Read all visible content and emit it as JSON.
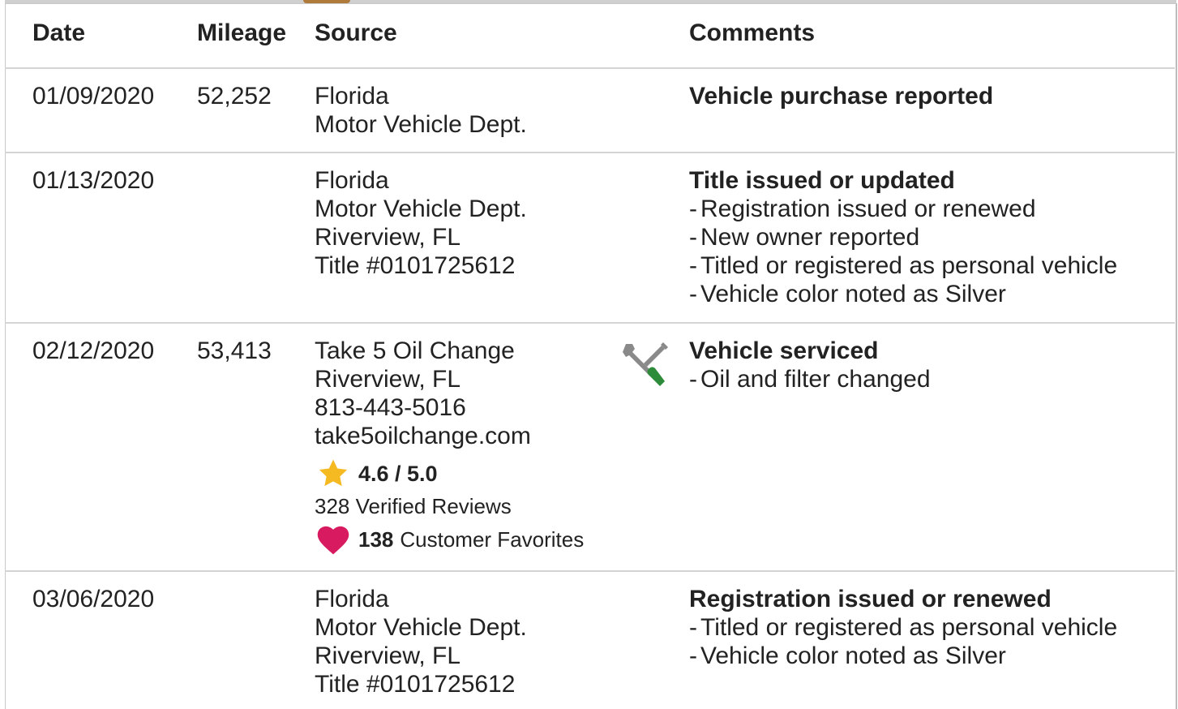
{
  "table": {
    "headers": {
      "date": "Date",
      "mileage": "Mileage",
      "source": "Source",
      "comments": "Comments"
    },
    "rows": [
      {
        "date": "01/09/2020",
        "mileage": "52,252",
        "source": [
          "Florida",
          "Motor Vehicle Dept."
        ],
        "comment_title": "Vehicle purchase reported",
        "comment_items": []
      },
      {
        "date": "01/13/2020",
        "mileage": "",
        "source": [
          "Florida",
          "Motor Vehicle Dept.",
          "Riverview, FL",
          "Title #0101725612"
        ],
        "comment_title": "Title issued or updated",
        "comment_items": [
          "Registration issued or renewed",
          "New owner reported",
          "Titled or registered as personal vehicle",
          "Vehicle color noted as Silver"
        ]
      },
      {
        "date": "02/12/2020",
        "mileage": "53,413",
        "source": [
          "Take 5 Oil Change",
          "Riverview, FL",
          "813-443-5016",
          "take5oilchange.com"
        ],
        "rating": "4.6 / 5.0",
        "reviews": "328 Verified Reviews",
        "favorites_count": "138",
        "favorites_label": "Customer Favorites",
        "icon": "service-tools-icon",
        "comment_title": "Vehicle serviced",
        "comment_items": [
          "Oil and filter changed"
        ]
      },
      {
        "date": "03/06/2020",
        "mileage": "",
        "source": [
          "Florida",
          "Motor Vehicle Dept.",
          "Riverview, FL",
          "Title #0101725612"
        ],
        "comment_title": "Registration issued or renewed",
        "comment_items": [
          "Titled or registered as personal vehicle",
          "Vehicle color noted as Silver"
        ]
      }
    ]
  },
  "icons": {
    "star": "star-icon",
    "heart": "heart-icon",
    "tools": "wrench-screwdriver-icon"
  },
  "colors": {
    "star": "#f5b921",
    "heart": "#d81b60",
    "screwdriver_handle": "#2e8b3a",
    "tool_metal": "#8a8a8a"
  }
}
